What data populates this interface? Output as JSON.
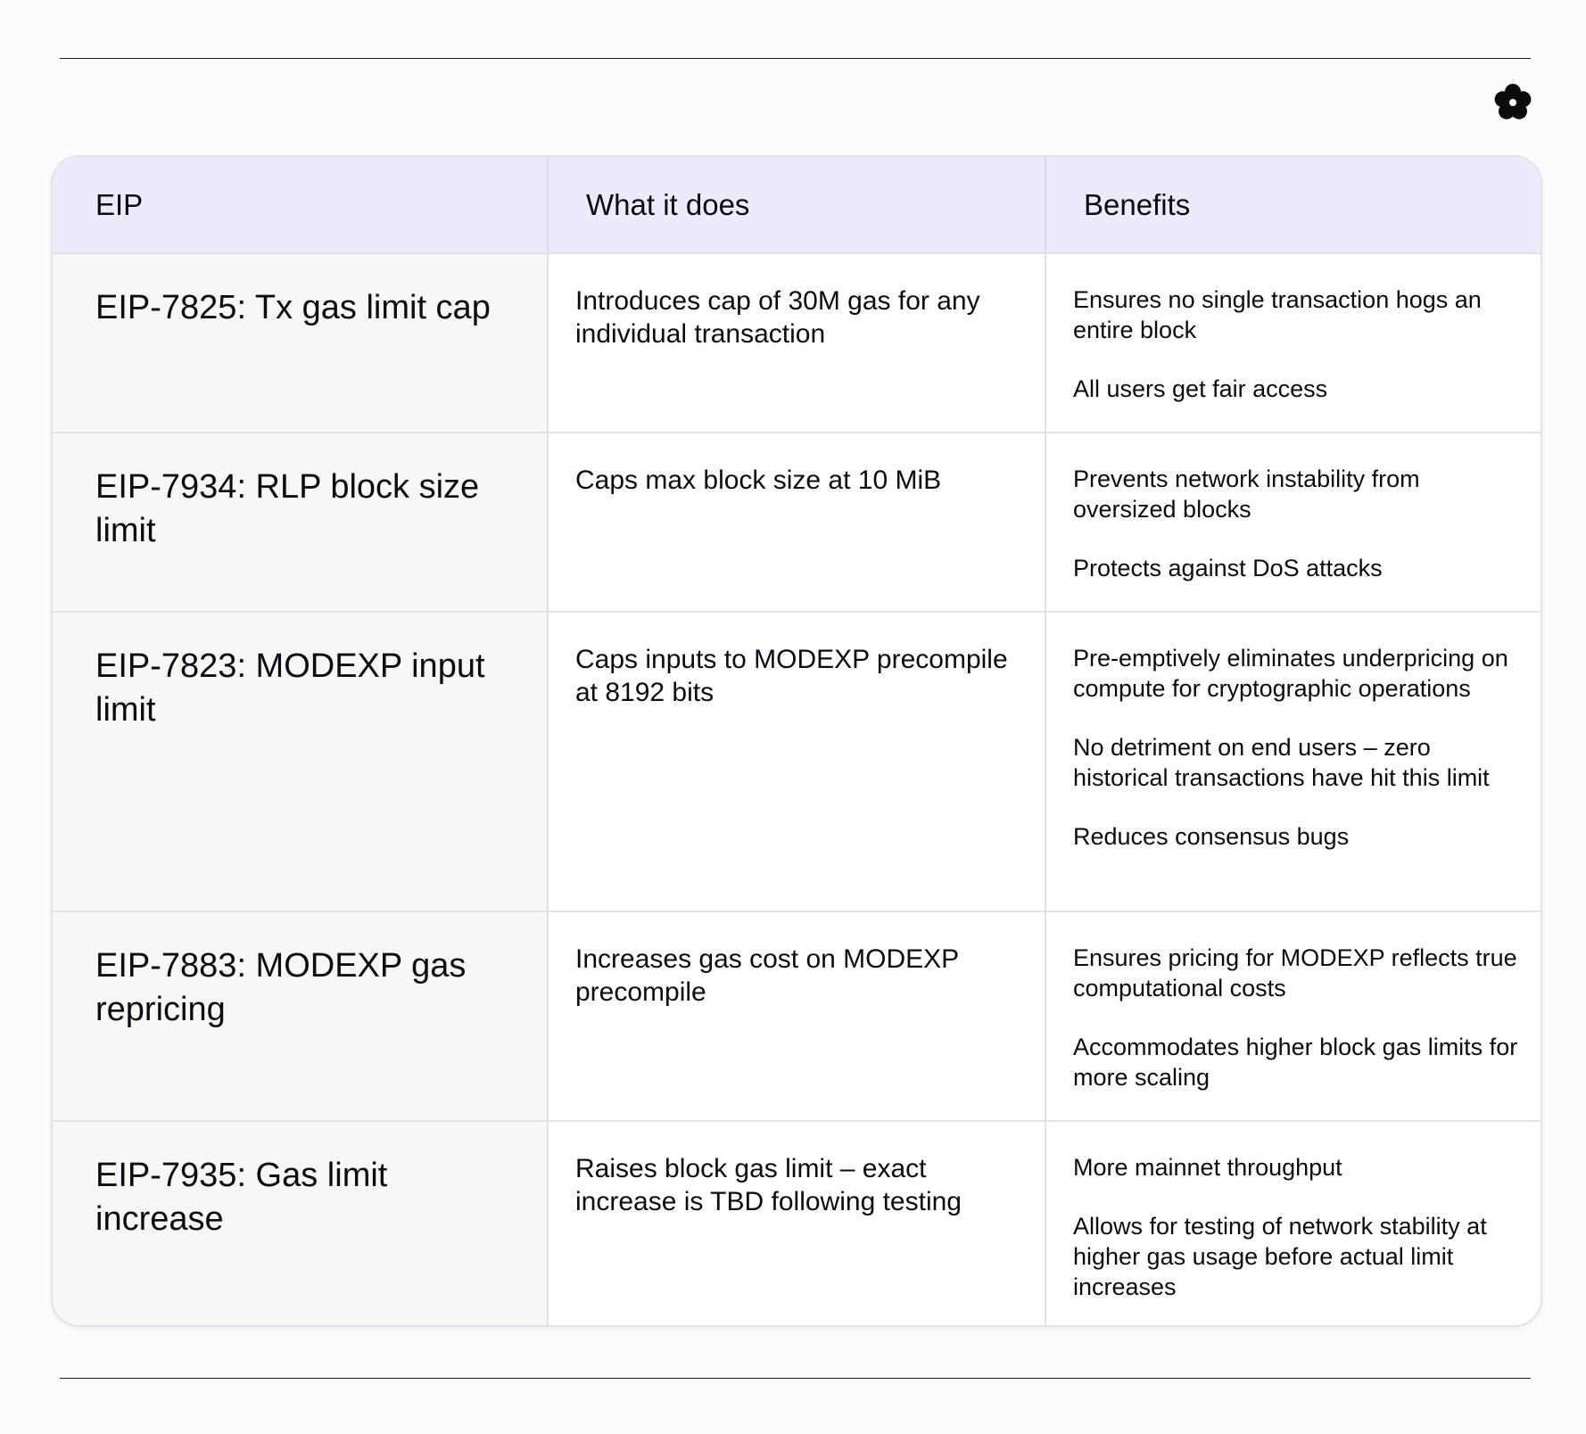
{
  "logo": {
    "icon": "flower-logo-icon"
  },
  "table": {
    "headers": [
      "EIP",
      "What it does",
      "Benefits"
    ],
    "rows": [
      {
        "eip": "EIP-7825: Tx gas limit cap",
        "what": "Introduces cap of 30M gas for any individual transaction",
        "benefits": [
          "Ensures no single transaction hogs an entire block",
          "All users get fair access"
        ]
      },
      {
        "eip": "EIP-7934: RLP block size limit",
        "what": "Caps max block size at 10 MiB",
        "benefits": [
          "Prevents network instability from oversized blocks",
          "Protects against DoS attacks"
        ]
      },
      {
        "eip": "EIP-7823: MODEXP input limit",
        "what": "Caps inputs to MODEXP precompile at 8192 bits",
        "benefits": [
          "Pre-emptively eliminates underpricing on compute for cryptographic operations",
          "No detriment on end users – zero historical transactions have hit this limit",
          "Reduces consensus bugs"
        ]
      },
      {
        "eip": "EIP-7883: MODEXP gas repricing",
        "what": "Increases gas cost on MODEXP precompile",
        "benefits": [
          "Ensures pricing for MODEXP reflects true computational costs",
          "Accommodates higher block gas limits for more scaling"
        ]
      },
      {
        "eip": "EIP-7935: Gas limit increase",
        "what": "Raises block gas limit – exact increase is TBD following testing",
        "benefits": [
          "More mainnet throughput",
          "Allows for testing of network stability at higher gas usage before actual limit increases"
        ]
      }
    ]
  }
}
